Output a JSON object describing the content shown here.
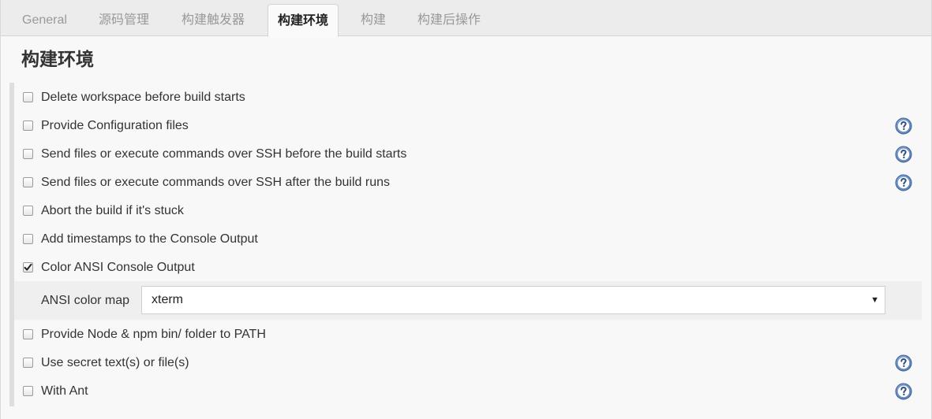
{
  "tabs": [
    {
      "label": "General",
      "active": false
    },
    {
      "label": "源码管理",
      "active": false
    },
    {
      "label": "构建触发器",
      "active": false
    },
    {
      "label": "构建环境",
      "active": true
    },
    {
      "label": "构建",
      "active": false
    },
    {
      "label": "构建后操作",
      "active": false
    }
  ],
  "section": {
    "title": "构建环境"
  },
  "options": [
    {
      "label": "Delete workspace before build starts",
      "checked": false,
      "help_icon": false
    },
    {
      "label": "Provide Configuration files",
      "checked": false,
      "help_icon": true
    },
    {
      "label": "Send files or execute commands over SSH before the build starts",
      "checked": false,
      "help_icon": true
    },
    {
      "label": "Send files or execute commands over SSH after the build runs",
      "checked": false,
      "help_icon": true
    },
    {
      "label": "Abort the build if it's stuck",
      "checked": false,
      "help_icon": false
    },
    {
      "label": "Add timestamps to the Console Output",
      "checked": false,
      "help_icon": false
    },
    {
      "label": "Color ANSI Console Output",
      "checked": true,
      "help_icon": false
    },
    {
      "label": "Provide Node & npm bin/ folder to PATH",
      "checked": false,
      "help_icon": false
    },
    {
      "label": "Use secret text(s) or file(s)",
      "checked": false,
      "help_icon": true
    },
    {
      "label": "With Ant",
      "checked": false,
      "help_icon": true
    }
  ],
  "ansi_color_map": {
    "label": "ANSI color map",
    "selected": "xterm",
    "arrow": "▼"
  },
  "colors": {
    "help_icon": "#5a7fb5",
    "checkmark": "#222222"
  },
  "icons": {
    "help": "question-circle-icon",
    "dropdown": "triangle-down-icon",
    "check": "checkmark-icon"
  }
}
